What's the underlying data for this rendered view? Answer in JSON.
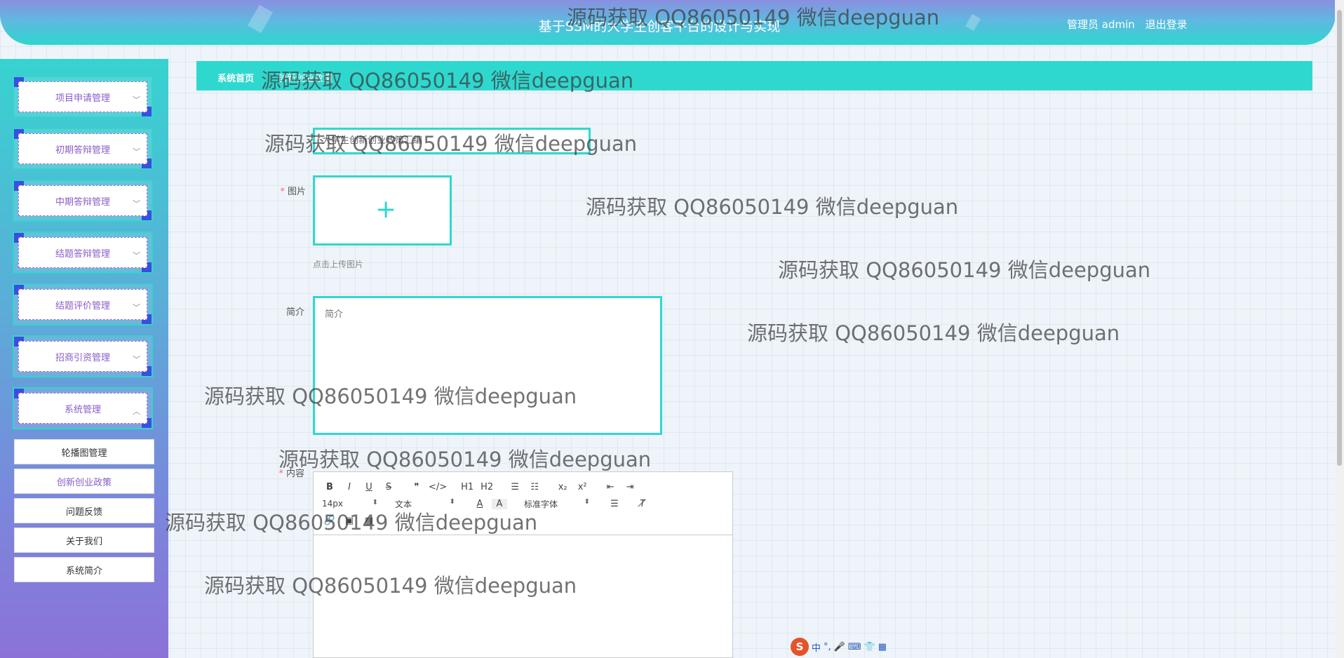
{
  "header": {
    "title": "基于SSM的大学生创客平台的设计与实现",
    "user_label": "管理员 admin",
    "logout_label": "退出登录"
  },
  "sidebar": {
    "groups": [
      {
        "label": "项目申请管理",
        "chevron": "chevron-down-icon"
      },
      {
        "label": "初期答辩管理",
        "chevron": "chevron-down-icon"
      },
      {
        "label": "中期答辩管理",
        "chevron": "chevron-down-icon"
      },
      {
        "label": "结题答辩管理",
        "chevron": "chevron-down-icon"
      },
      {
        "label": "结题评价管理",
        "chevron": "chevron-down-icon"
      },
      {
        "label": "招商引资管理",
        "chevron": "chevron-down-icon"
      },
      {
        "label": "系统管理",
        "chevron": "chevron-up-icon"
      }
    ],
    "sub_items": [
      {
        "label": "轮播图管理",
        "active": false
      },
      {
        "label": "创新创业政策",
        "active": true
      },
      {
        "label": "问题反馈",
        "active": false
      },
      {
        "label": "关于我们",
        "active": false
      },
      {
        "label": "系统简介",
        "active": false
      }
    ]
  },
  "breadcrumb": {
    "home": "系统首页",
    "current": "创新创业政策"
  },
  "form": {
    "title_value": "大学生创新创业政策汇编",
    "image_label": "图片",
    "upload_hint": "点击上传图片",
    "intro_label": "简介",
    "intro_placeholder": "简介",
    "content_label": "内容"
  },
  "editor": {
    "row1": [
      "B",
      "I",
      "U",
      "S",
      "❞",
      "</>",
      "H1",
      "H2",
      "☰",
      "☷",
      "x₂",
      "x²",
      "⇤",
      "⇥"
    ],
    "font_size": "14px",
    "block_type": "文本",
    "font_family": "标准字体",
    "row3": [
      "🔗",
      "▣",
      "▦"
    ]
  },
  "ime": {
    "logo": "S",
    "mode": "中"
  },
  "watermark": "源码获取 QQ86050149 微信deepguan",
  "colors": {
    "accent": "#2fd8cf",
    "menu_text": "#8a5dc8",
    "required": "#f56c6c"
  }
}
